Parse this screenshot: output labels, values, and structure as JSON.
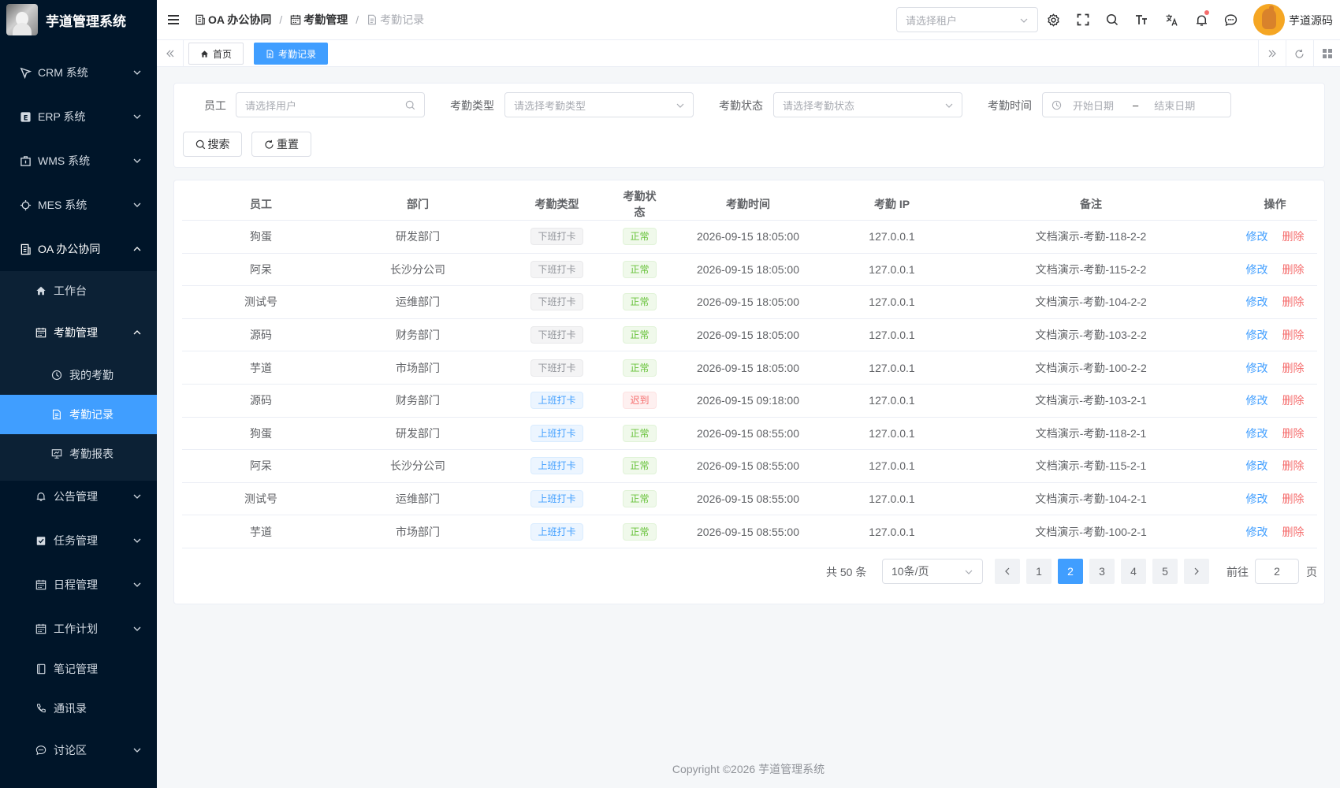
{
  "app": {
    "title": "芋道管理系统"
  },
  "sidebar": {
    "items": [
      {
        "label": "CRM 系统",
        "icon": "crm-icon"
      },
      {
        "label": "ERP 系统",
        "icon": "erp-icon"
      },
      {
        "label": "WMS 系统",
        "icon": "wms-icon"
      },
      {
        "label": "MES 系统",
        "icon": "mes-icon"
      },
      {
        "label": "OA 办公协同",
        "icon": "office-icon"
      },
      {
        "label": "工作台",
        "icon": "home-icon"
      },
      {
        "label": "考勤管理",
        "icon": "calendar-icon"
      },
      {
        "label": "我的考勤",
        "icon": "clock-icon"
      },
      {
        "label": "考勤记录",
        "icon": "document-icon"
      },
      {
        "label": "考勤报表",
        "icon": "report-icon"
      },
      {
        "label": "公告管理",
        "icon": "bell-icon"
      },
      {
        "label": "任务管理",
        "icon": "task-icon"
      },
      {
        "label": "日程管理",
        "icon": "calendar-icon"
      },
      {
        "label": "工作计划",
        "icon": "calendar-icon"
      },
      {
        "label": "笔记管理",
        "icon": "notebook-icon"
      },
      {
        "label": "通讯录",
        "icon": "phone-icon"
      },
      {
        "label": "讨论区",
        "icon": "chat-icon"
      }
    ]
  },
  "header": {
    "breadcrumb": [
      "OA 办公协同",
      "考勤管理",
      "考勤记录"
    ],
    "tenant_placeholder": "请选择租户",
    "user_name": "芋道源码"
  },
  "tags": {
    "home": "首页",
    "current": "考勤记录"
  },
  "search": {
    "employee_label": "员工",
    "employee_placeholder": "请选择用户",
    "type_label": "考勤类型",
    "type_placeholder": "请选择考勤类型",
    "status_label": "考勤状态",
    "status_placeholder": "请选择考勤状态",
    "time_label": "考勤时间",
    "start_placeholder": "开始日期",
    "range_sep": "–",
    "end_placeholder": "结束日期",
    "search_btn": "搜索",
    "reset_btn": "重置"
  },
  "table": {
    "columns": [
      "员工",
      "部门",
      "考勤类型",
      "考勤状态",
      "考勤时间",
      "考勤 IP",
      "备注",
      "操作"
    ],
    "edit_label": "修改",
    "delete_label": "删除",
    "rows": [
      {
        "employee": "狗蛋",
        "dept": "研发部门",
        "type": "下班打卡",
        "status": "正常",
        "time": "2026-09-15 18:05:00",
        "ip": "127.0.0.1",
        "remark": "文档演示-考勤-118-2-2"
      },
      {
        "employee": "阿呆",
        "dept": "长沙分公司",
        "type": "下班打卡",
        "status": "正常",
        "time": "2026-09-15 18:05:00",
        "ip": "127.0.0.1",
        "remark": "文档演示-考勤-115-2-2"
      },
      {
        "employee": "测试号",
        "dept": "运维部门",
        "type": "下班打卡",
        "status": "正常",
        "time": "2026-09-15 18:05:00",
        "ip": "127.0.0.1",
        "remark": "文档演示-考勤-104-2-2"
      },
      {
        "employee": "源码",
        "dept": "财务部门",
        "type": "下班打卡",
        "status": "正常",
        "time": "2026-09-15 18:05:00",
        "ip": "127.0.0.1",
        "remark": "文档演示-考勤-103-2-2"
      },
      {
        "employee": "芋道",
        "dept": "市场部门",
        "type": "下班打卡",
        "status": "正常",
        "time": "2026-09-15 18:05:00",
        "ip": "127.0.0.1",
        "remark": "文档演示-考勤-100-2-2"
      },
      {
        "employee": "源码",
        "dept": "财务部门",
        "type": "上班打卡",
        "status": "迟到",
        "time": "2026-09-15 09:18:00",
        "ip": "127.0.0.1",
        "remark": "文档演示-考勤-103-2-1"
      },
      {
        "employee": "狗蛋",
        "dept": "研发部门",
        "type": "上班打卡",
        "status": "正常",
        "time": "2026-09-15 08:55:00",
        "ip": "127.0.0.1",
        "remark": "文档演示-考勤-118-2-1"
      },
      {
        "employee": "阿呆",
        "dept": "长沙分公司",
        "type": "上班打卡",
        "status": "正常",
        "time": "2026-09-15 08:55:00",
        "ip": "127.0.0.1",
        "remark": "文档演示-考勤-115-2-1"
      },
      {
        "employee": "测试号",
        "dept": "运维部门",
        "type": "上班打卡",
        "status": "正常",
        "time": "2026-09-15 08:55:00",
        "ip": "127.0.0.1",
        "remark": "文档演示-考勤-104-2-1"
      },
      {
        "employee": "芋道",
        "dept": "市场部门",
        "type": "上班打卡",
        "status": "正常",
        "time": "2026-09-15 08:55:00",
        "ip": "127.0.0.1",
        "remark": "文档演示-考勤-100-2-1"
      }
    ]
  },
  "pagination": {
    "total": "共 50 条",
    "page_size": "10条/页",
    "pages": [
      "1",
      "2",
      "3",
      "4",
      "5"
    ],
    "current": "2",
    "goto_label": "前往",
    "goto_value": "2",
    "page_suffix": "页"
  },
  "footer": {
    "copyright": "Copyright ©2026 芋道管理系统"
  },
  "colors": {
    "sidebar_bg": "#001529",
    "primary": "#409eff",
    "success": "#67c23a",
    "danger": "#f56c6c",
    "info": "#909399"
  }
}
